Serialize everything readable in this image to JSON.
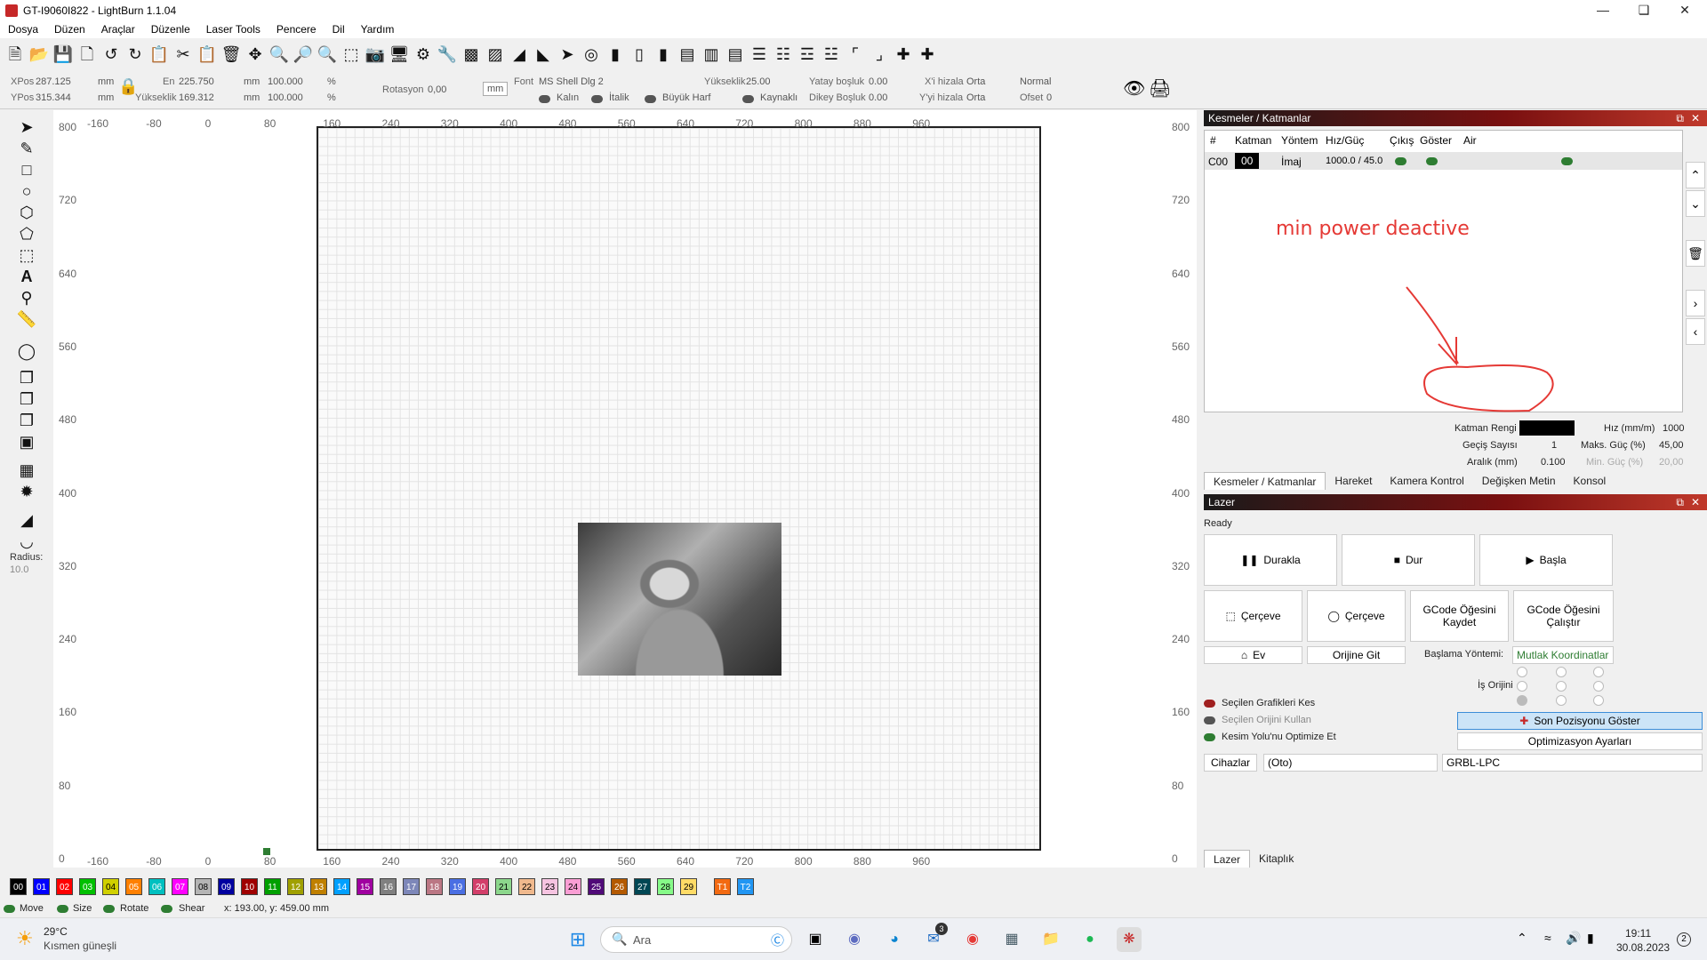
{
  "window": {
    "title": "GT-I9060I822 - LightBurn 1.1.04",
    "minimize_icon": "minimize-icon",
    "maximize_icon": "maximize-icon",
    "close_icon": "close-icon"
  },
  "menu": [
    "Dosya",
    "Düzen",
    "Araçlar",
    "Düzenle",
    "Laser Tools",
    "Pencere",
    "Dil",
    "Yardım"
  ],
  "options": {
    "xpos_label": "XPos",
    "xpos": "287.125",
    "ypos_label": "YPos",
    "ypos": "315.344",
    "unit": "mm",
    "width_label": "En",
    "width": "225.750",
    "height_label": "Yükseklik",
    "height": "169.312",
    "scale_x": "100.000",
    "scale_y": "100.000",
    "percent": "%",
    "rotation_label": "Rotasyon",
    "rotation": "0,00",
    "mm_button": "mm",
    "font_label": "Font",
    "font": "MS Shell Dlg 2",
    "text_height_label": "Yükseklik",
    "text_height": "25.00",
    "hspace_label": "Yatay boşluk",
    "hspace": "0.00",
    "vspace_label": "Dikey Boşluk",
    "vspace": "0.00",
    "xalign_label": "X'i hizala",
    "xalign": "Orta",
    "yalign_label": "Y'yi hizala",
    "yalign": "Orta",
    "mode": "Normal",
    "offset_label": "Ofset",
    "offset": "0",
    "bold": "Kalın",
    "italic": "İtalik",
    "upper": "Büyük Harf",
    "welded": "Kaynaklı"
  },
  "left_tools": {
    "radius_label": "Radius:",
    "radius": "10.0"
  },
  "axis": {
    "top_x": [
      "-160",
      "-80",
      "0",
      "80",
      "160",
      "240",
      "320",
      "400",
      "480",
      "560",
      "640",
      "720",
      "800",
      "880",
      "960"
    ],
    "bottom_x": [
      "-160",
      "-80",
      "0",
      "80",
      "160",
      "240",
      "320",
      "400",
      "480",
      "560",
      "640",
      "720",
      "800",
      "880",
      "960"
    ],
    "left_y": [
      "800",
      "720",
      "640",
      "560",
      "480",
      "400",
      "320",
      "240",
      "160",
      "80",
      "0"
    ],
    "right_y": [
      "800",
      "720",
      "640",
      "560",
      "480",
      "400",
      "320",
      "240",
      "160",
      "80",
      "0"
    ]
  },
  "annotation": "min power deactive",
  "cuts": {
    "title": "Kesmeler / Katmanlar",
    "headers": [
      "#",
      "Katman",
      "Yöntem",
      "Hız/Güç",
      "Çıkış",
      "Göster",
      "Air"
    ],
    "row": {
      "num": "C00",
      "layer": "00",
      "mode": "İmaj",
      "speed_power": "1000.0 / 45.0"
    },
    "layer_color_label": "Katman Rengi",
    "pass_label": "Geçiş Sayısı",
    "pass": "1",
    "interval_label": "Aralık (mm)",
    "interval": "0.100",
    "speed_label": "Hız (mm/m)",
    "speed": "1000",
    "maxpow_label": "Maks. Güç (%)",
    "maxpow": "45,00",
    "minpow_label": "Min. Güç (%)",
    "minpow": "20,00"
  },
  "tabs1": [
    "Kesmeler / Katmanlar",
    "Hareket",
    "Kamera Kontrol",
    "Değişken Metin",
    "Konsol"
  ],
  "laser": {
    "title": "Lazer",
    "status": "Ready",
    "pause": "Durakla",
    "stop": "Dur",
    "start": "Başla",
    "frame1": "Çerçeve",
    "frame2": "Çerçeve",
    "save_gcode": "GCode Öğesini Kaydet",
    "run_gcode": "GCode Öğesini Çalıştır",
    "home": "Ev",
    "goto_origin": "Orijine Git",
    "start_mode_label": "Başlama Yöntemi:",
    "start_mode": "Mutlak Koordinatlar",
    "job_origin_label": "İş Orijini",
    "cut_selected": "Seçilen Grafikleri Kes",
    "use_origin": "Seçilen Orijini Kullan",
    "optimize": "Kesim Yolu'nu Optimize Et",
    "show_last": "Son Pozisyonu Göster",
    "opt_settings": "Optimizasyon Ayarları",
    "devices": "Cihazlar",
    "port": "(Oto)",
    "device": "GRBL-LPC"
  },
  "tabs2": [
    "Lazer",
    "Kitaplık"
  ],
  "palette": [
    {
      "l": "00",
      "c": "#000000"
    },
    {
      "l": "01",
      "c": "#0000ff"
    },
    {
      "l": "02",
      "c": "#ff0000"
    },
    {
      "l": "03",
      "c": "#00c000"
    },
    {
      "l": "04",
      "c": "#d0d000"
    },
    {
      "l": "05",
      "c": "#ff8000"
    },
    {
      "l": "06",
      "c": "#00c0c0"
    },
    {
      "l": "07",
      "c": "#ff00ff"
    },
    {
      "l": "08",
      "c": "#b4b4b4"
    },
    {
      "l": "09",
      "c": "#0000a0"
    },
    {
      "l": "10",
      "c": "#a00000"
    },
    {
      "l": "11",
      "c": "#00a000"
    },
    {
      "l": "12",
      "c": "#a0a000"
    },
    {
      "l": "13",
      "c": "#c08000"
    },
    {
      "l": "14",
      "c": "#00a0ff"
    },
    {
      "l": "15",
      "c": "#a000a0"
    },
    {
      "l": "16",
      "c": "#808080"
    },
    {
      "l": "17",
      "c": "#7d87b9"
    },
    {
      "l": "18",
      "c": "#bb7784"
    },
    {
      "l": "19",
      "c": "#4a6fe3"
    },
    {
      "l": "20",
      "c": "#d33f6a"
    },
    {
      "l": "21",
      "c": "#8cd78c"
    },
    {
      "l": "22",
      "c": "#f0b98d"
    },
    {
      "l": "23",
      "c": "#f6c4e1"
    },
    {
      "l": "24",
      "c": "#fa9ed4"
    },
    {
      "l": "25",
      "c": "#500a78"
    },
    {
      "l": "26",
      "c": "#b45a00"
    },
    {
      "l": "27",
      "c": "#004754"
    },
    {
      "l": "28",
      "c": "#86fa88"
    },
    {
      "l": "29",
      "c": "#ffdb66"
    },
    {
      "l": "T1",
      "c": "#f36a12"
    },
    {
      "l": "T2",
      "c": "#2196f3"
    }
  ],
  "status": {
    "move": "Move",
    "size": "Size",
    "rotate": "Rotate",
    "shear": "Shear",
    "coords": "x: 193.00, y: 459.00 mm"
  },
  "taskbar": {
    "temp": "29°C",
    "weather": "Kısmen güneşli",
    "search": "Ara",
    "time": "19:11",
    "date": "30.08.2023",
    "badge": "3",
    "notif": "2"
  }
}
